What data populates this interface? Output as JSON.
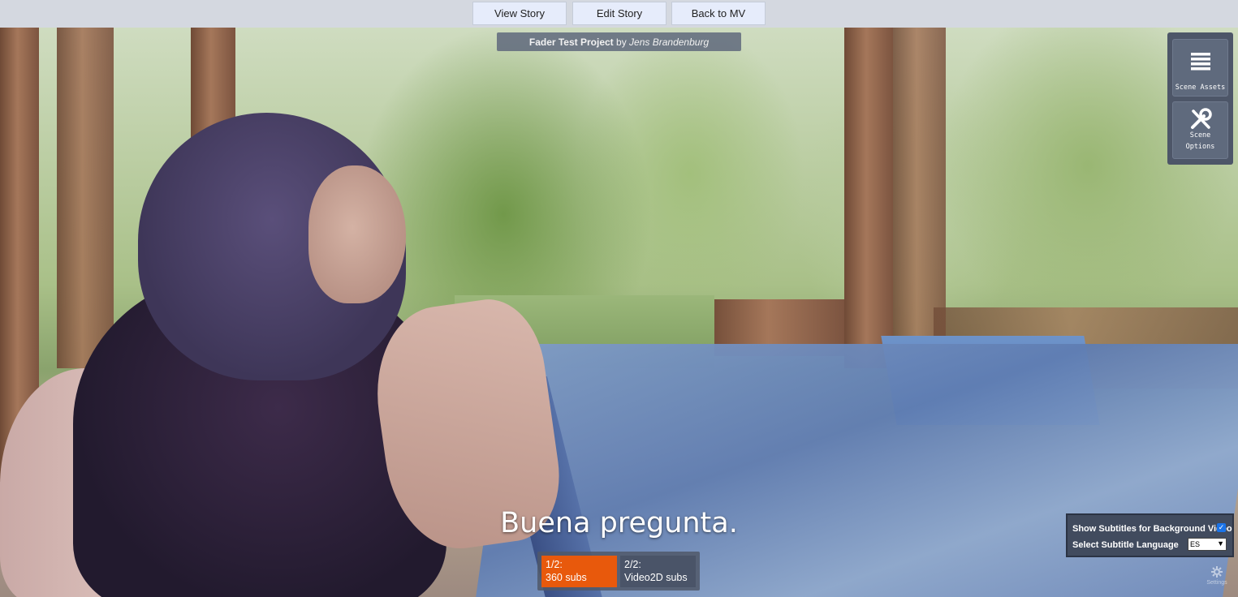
{
  "nav": {
    "view_story": "View Story",
    "edit_story": "Edit Story",
    "back_to_mv": "Back to MV"
  },
  "project": {
    "name": "Fader Test Project",
    "by": "by",
    "author": "Jens Brandenburg"
  },
  "side_panel": {
    "scene_assets": "Scene Assets",
    "scene_options_line1": "Scene",
    "scene_options_line2": "Options"
  },
  "subtitle": {
    "text": "Buena pregunta."
  },
  "subtitle_tabs": [
    {
      "index": "1/2:",
      "label": "360 subs",
      "active": true
    },
    {
      "index": "2/2:",
      "label": "Video2D subs",
      "active": false
    }
  ],
  "subtitle_settings": {
    "show_label": "Show Subtitles for Background Video",
    "show_checked": true,
    "language_label": "Select Subtitle Language",
    "language_value": "ES"
  },
  "settings_corner": {
    "label": "Settings"
  },
  "colors": {
    "active_tab": "#e8590c",
    "inactive_tab": "#4a5468",
    "panel": "#4d5668"
  },
  "icons": {
    "scene_assets": "list-icon",
    "scene_options": "tools-icon",
    "settings": "gear-icon",
    "checkbox": "check-icon",
    "select": "chevron-down-icon"
  }
}
